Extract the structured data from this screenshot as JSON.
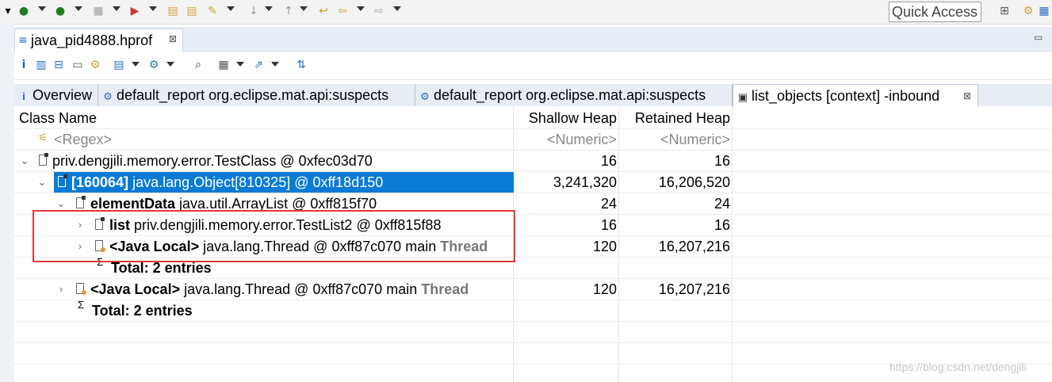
{
  "toolbar": {
    "quick_access": "Quick Access"
  },
  "editor": {
    "tab_label": "java_pid4888.hprof",
    "tab_close": "⊠"
  },
  "result_tabs": [
    {
      "icon": "i",
      "label": "Overview"
    },
    {
      "icon": "⚙",
      "label": "default_report  org.eclipse.mat.api:suspects"
    },
    {
      "icon": "⚙",
      "label": "default_report  org.eclipse.mat.api:suspects"
    },
    {
      "icon": "▣",
      "label": "list_objects [context] -inbound",
      "close": "⊠",
      "active": true
    }
  ],
  "table": {
    "columns": [
      "Class Name",
      "Shallow Heap",
      "Retained Heap"
    ],
    "filter": {
      "name": "<Regex>",
      "shallow": "<Numeric>",
      "retained": "<Numeric>"
    },
    "rows": [
      {
        "prefix": "",
        "name": "priv.dengjili.memory.error.TestClass @ 0xfec03d70",
        "suffix": "",
        "shallow": "16",
        "retained": "16"
      },
      {
        "prefix": "[160064]",
        "name": " java.lang.Object[810325] @ 0xff18d150",
        "suffix": "",
        "shallow": "3,241,320",
        "retained": "16,206,520"
      },
      {
        "prefix": "elementData",
        "name": " java.util.ArrayList @ 0xff815f70",
        "suffix": "",
        "shallow": "24",
        "retained": "24"
      },
      {
        "prefix": "list",
        "name": " priv.dengjili.memory.error.TestList2 @ 0xff815f88",
        "suffix": "",
        "shallow": "16",
        "retained": "16"
      },
      {
        "prefix": "<Java Local>",
        "name": " java.lang.Thread @ 0xff87c070  main ",
        "suffix": "Thread",
        "shallow": "120",
        "retained": "16,207,216"
      },
      {
        "total": "Total: 2 entries"
      },
      {
        "prefix": "<Java Local>",
        "name": " java.lang.Thread @ 0xff87c070  main ",
        "suffix": "Thread",
        "shallow": "120",
        "retained": "16,207,216"
      },
      {
        "total": "Total: 2 entries"
      }
    ]
  },
  "watermark": "https://blog.csdn.net/dengjili"
}
